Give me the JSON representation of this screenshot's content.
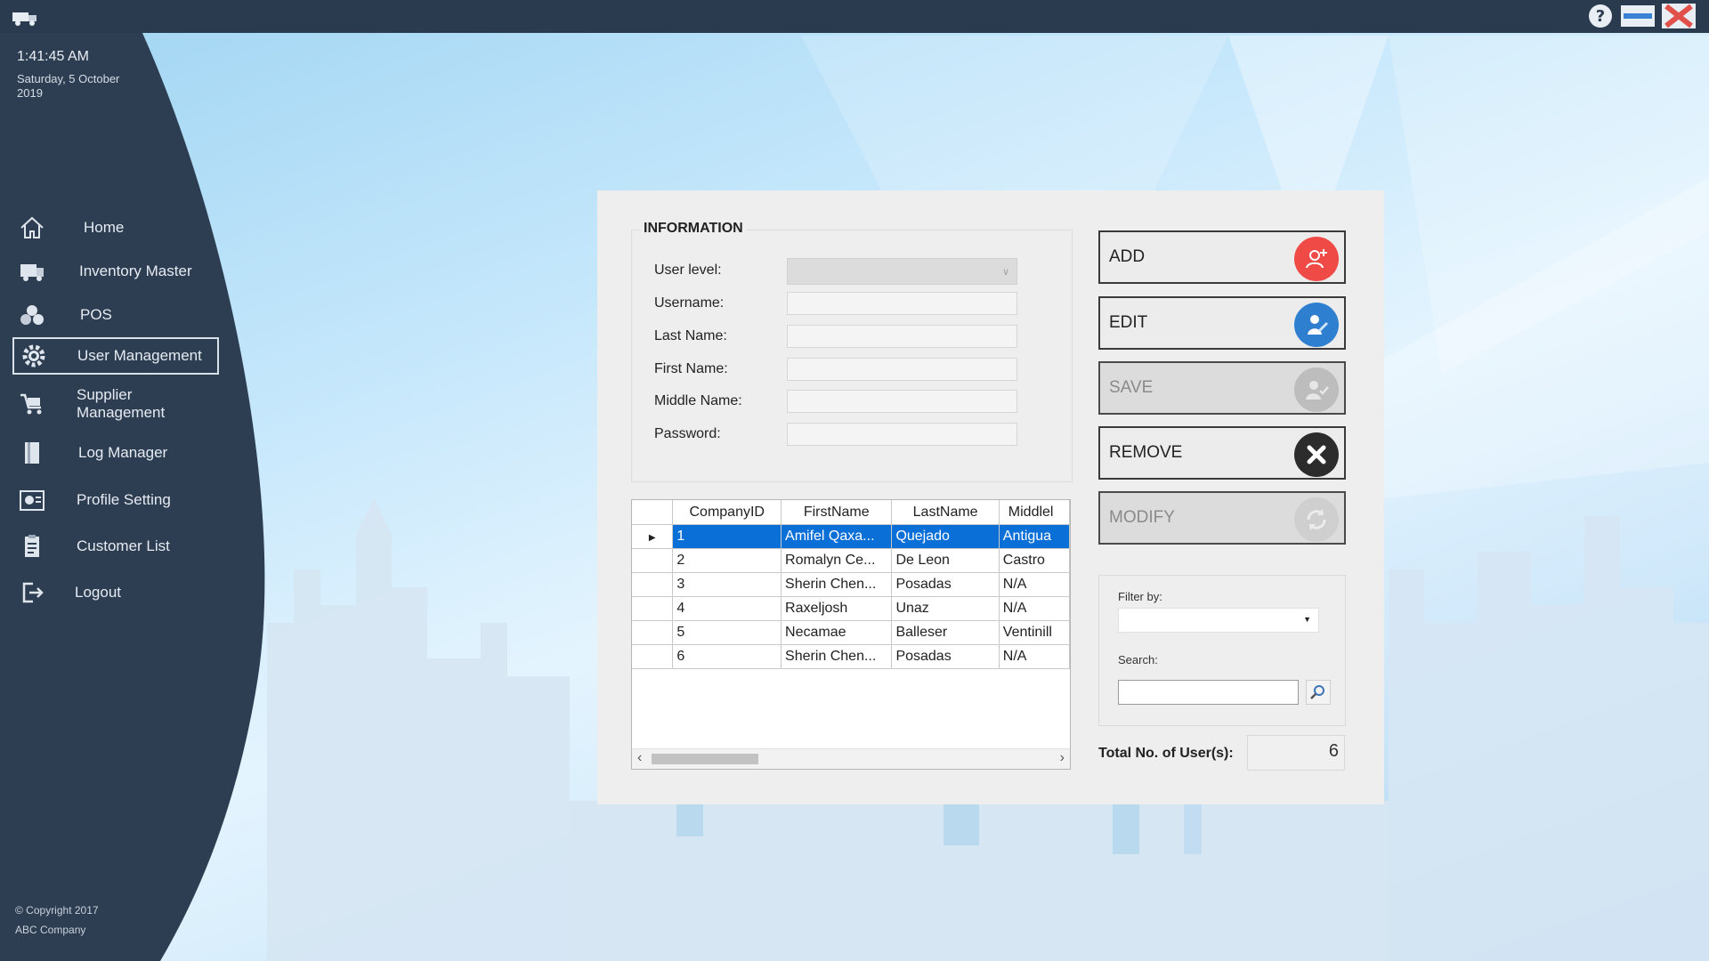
{
  "clock": {
    "time": "1:41:45 AM",
    "date": "Saturday, 5 October 2019"
  },
  "nav": {
    "items": [
      {
        "label": "Home",
        "icon": "home-icon"
      },
      {
        "label": "Inventory Master",
        "icon": "truck-icon"
      },
      {
        "label": "POS",
        "icon": "boxes-icon"
      },
      {
        "label": "User Management",
        "icon": "gear-icon",
        "active": true
      },
      {
        "label": "Supplier Management",
        "icon": "cart-icon"
      },
      {
        "label": "Log Manager",
        "icon": "book-icon"
      },
      {
        "label": "Profile Setting",
        "icon": "profile-icon"
      },
      {
        "label": "Customer List",
        "icon": "clipboard-icon"
      },
      {
        "label": "Logout",
        "icon": "logout-icon"
      }
    ]
  },
  "copyright": {
    "line1": "© Copyright 2017",
    "line2": "ABC Company"
  },
  "info": {
    "title": "INFORMATION",
    "labels": {
      "user_level": "User level:",
      "username": "Username:",
      "last_name": "Last Name:",
      "first_name": "First Name:",
      "middle_name": "Middle Name:",
      "password": "Password:"
    }
  },
  "grid": {
    "columns": [
      "CompanyID",
      "FirstName",
      "LastName",
      "Middlel"
    ],
    "rows": [
      [
        "1",
        "Amifel Qaxa...",
        "Quejado",
        "Antigua"
      ],
      [
        "2",
        "Romalyn Ce...",
        "De Leon",
        "Castro"
      ],
      [
        "3",
        "Sherin Chen...",
        "Posadas",
        "N/A"
      ],
      [
        "4",
        "Raxeljosh",
        "Unaz",
        "N/A"
      ],
      [
        "5",
        "Necamae",
        "Balleser",
        "Ventinill"
      ],
      [
        "6",
        "Sherin Chen...",
        "Posadas",
        "N/A"
      ]
    ],
    "selected_row": 0
  },
  "actions": {
    "add": "ADD",
    "edit": "EDIT",
    "save": "SAVE",
    "remove": "REMOVE",
    "modify": "MODIFY"
  },
  "filter": {
    "filter_label": "Filter by:",
    "search_label": "Search:"
  },
  "total": {
    "label": "Total No. of User(s):",
    "value": "6"
  },
  "colors": {
    "sidebar": "#2e3e52",
    "titlebar": "#2a3a4f",
    "selection": "#0b6fd8",
    "add": "#ef4a45",
    "edit": "#2f7fd0",
    "remove": "#2c2c2c"
  }
}
